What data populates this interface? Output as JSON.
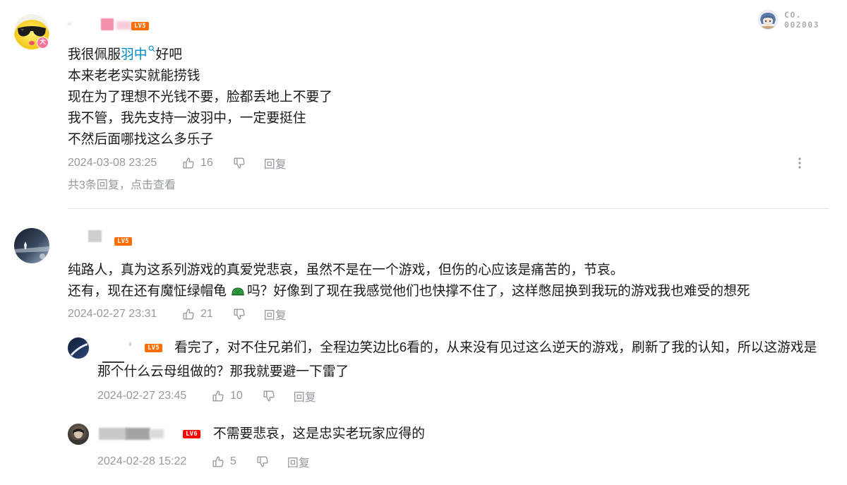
{
  "theme": {
    "text_color": "#18191c",
    "meta_color": "#9499a0",
    "link_color": "#008ac5",
    "divider_color": "#e3e5e7",
    "vip_badge_color": "#fb7299"
  },
  "icons": {
    "like": "thumbs-up-icon",
    "dislike": "thumbs-down-icon",
    "more": "more-vertical-icon",
    "link_search": "search-icon",
    "emoji": "green-turtle-emoji-icon"
  },
  "comments": [
    {
      "vip_badge": "大",
      "level": "LV5",
      "level_color": "#ff6c00",
      "decoration": {
        "line1": "CO.",
        "line2": "002003"
      },
      "content": {
        "before_link": "我很佩服",
        "link": "羽中",
        "after_link": "好吧",
        "lines": [
          "本来老老实实就能捞钱",
          "现在为了理想不光钱不要，脸都丢地上不要了",
          "我不管，我先支持一波羽中，一定要挺住",
          "不然后面哪找这么多乐子"
        ]
      },
      "time": "2024-03-08 23:25",
      "likes": "16",
      "reply_label": "回复",
      "reply_summary": "共3条回复，",
      "view_link": "点击查看"
    },
    {
      "level": "LV5",
      "level_color": "#ff6c00",
      "content": {
        "line1": "纯路人，真为这系列游戏的真爱党悲哀，虽然不是在一个游戏，但伤的心应该是痛苦的，节哀。",
        "line2_before_emoji": "还有，现在还有魔怔绿帽龟",
        "line2_after_emoji": "吗？好像到了现在我感觉他们也快撑不住了，这样憋屈换到我玩的游戏我也难受的想死"
      },
      "time": "2024-02-27 23:31",
      "likes": "21",
      "reply_label": "回复",
      "replies": [
        {
          "level": "LV5",
          "level_color": "#ff6c00",
          "content": "看完了，对不住兄弟们，全程边笑边比6看的，从来没有见过这么逆天的游戏，刷新了我的认知，所以这游戏是那个什么云母组做的？那我就要避一下雷了",
          "time": "2024-02-27 23:45",
          "likes": "10",
          "reply_label": "回复"
        },
        {
          "level": "LV6",
          "level_color": "#ff0000",
          "content": "不需要悲哀，这是忠实老玩家应得的",
          "time": "2024-02-28 15:22",
          "likes": "5",
          "reply_label": "回复"
        }
      ]
    }
  ]
}
